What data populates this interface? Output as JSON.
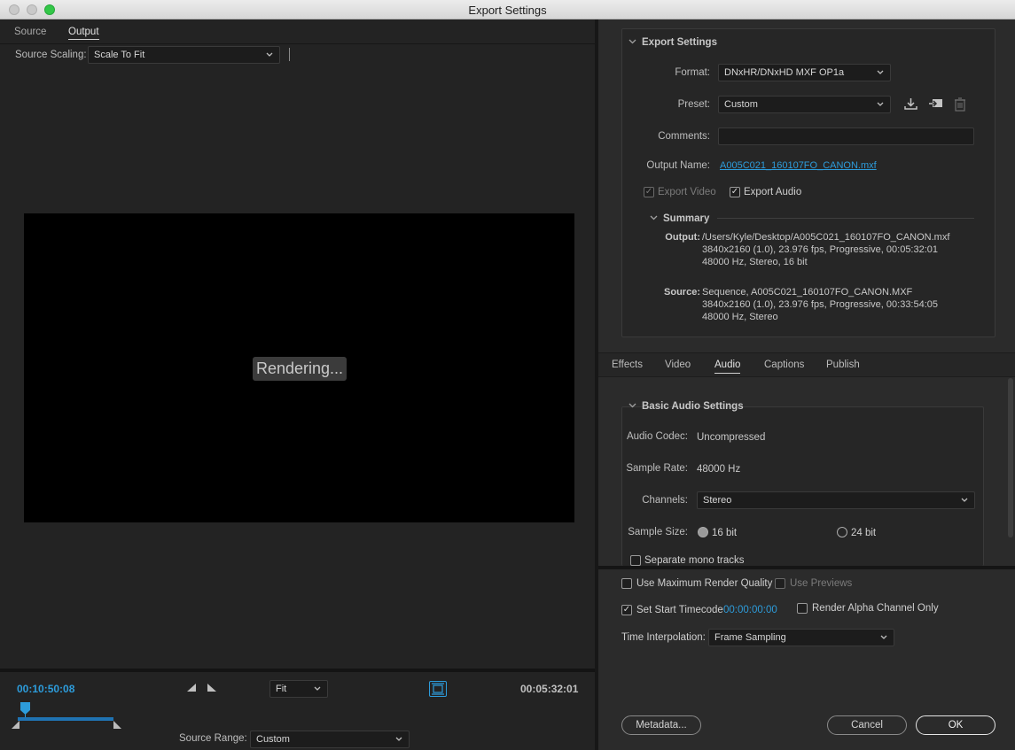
{
  "window": {
    "title": "Export Settings"
  },
  "source_tabs": [
    "Source",
    "Output"
  ],
  "source_scaling": {
    "label": "Source Scaling:",
    "value": "Scale To Fit"
  },
  "preview": {
    "status": "Rendering..."
  },
  "timeline": {
    "in_time": "00:10:50:08",
    "out_time": "00:05:32:01",
    "zoom": "Fit",
    "source_range_label": "Source Range:",
    "source_range_value": "Custom"
  },
  "export_settings": {
    "title": "Export Settings",
    "format_label": "Format:",
    "format_value": "DNxHR/DNxHD MXF OP1a",
    "preset_label": "Preset:",
    "preset_value": "Custom",
    "comments_label": "Comments:",
    "comments_value": "",
    "output_name_label": "Output Name:",
    "output_name_value": "A005C021_160107FO_CANON.mxf",
    "export_video_label": "Export Video",
    "export_audio_label": "Export Audio"
  },
  "summary": {
    "title": "Summary",
    "output_label": "Output:",
    "output_lines": [
      "/Users/Kyle/Desktop/A005C021_160107FO_CANON.mxf",
      "3840x2160 (1.0), 23.976 fps, Progressive, 00:05:32:01",
      "48000 Hz, Stereo, 16 bit"
    ],
    "source_label": "Source:",
    "source_lines": [
      "Sequence, A005C021_160107FO_CANON.MXF",
      "3840x2160 (1.0), 23.976 fps, Progressive, 00:33:54:05",
      "48000 Hz, Stereo"
    ]
  },
  "panel_tabs": [
    "Effects",
    "Video",
    "Audio",
    "Captions",
    "Publish"
  ],
  "basic_audio": {
    "title": "Basic Audio Settings",
    "codec_label": "Audio Codec:",
    "codec_value": "Uncompressed",
    "rate_label": "Sample Rate:",
    "rate_value": "48000 Hz",
    "channels_label": "Channels:",
    "channels_value": "Stereo",
    "size_label": "Sample Size:",
    "size_16": "16 bit",
    "size_24": "24 bit",
    "separate_mono": "Separate mono tracks"
  },
  "bottom_options": {
    "max_render_quality": "Use Maximum Render Quality",
    "use_previews": "Use Previews",
    "set_start_tc": "Set Start Timecode",
    "start_tc_value": "00:00:00:00",
    "render_alpha": "Render Alpha Channel Only",
    "interp_label": "Time Interpolation:",
    "interp_value": "Frame Sampling"
  },
  "buttons": {
    "metadata": "Metadata...",
    "cancel": "Cancel",
    "ok": "OK"
  },
  "colors": {
    "accent": "#2d9cdb",
    "background": "#232323",
    "panel": "#2b2b2b"
  }
}
